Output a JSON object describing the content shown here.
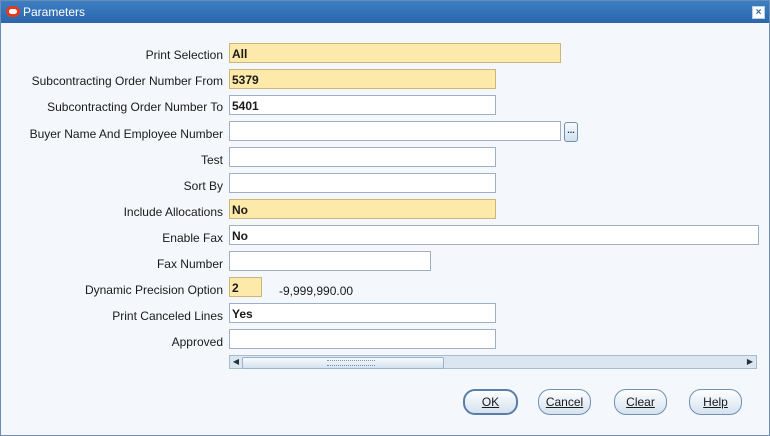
{
  "window": {
    "title": "Parameters",
    "close_glyph": "×"
  },
  "fields": [
    {
      "label": "Print Selection",
      "value": "All"
    },
    {
      "label": "Subcontracting Order Number From",
      "value": "5379"
    },
    {
      "label": "Subcontracting Order Number To",
      "value": "5401"
    },
    {
      "label": "Buyer Name And Employee Number",
      "value": ""
    },
    {
      "label": "Test",
      "value": ""
    },
    {
      "label": "Sort By",
      "value": ""
    },
    {
      "label": "Include Allocations",
      "value": "No"
    },
    {
      "label": "Enable Fax",
      "value": "No"
    },
    {
      "label": "Fax Number",
      "value": ""
    },
    {
      "label": "Dynamic Precision Option",
      "value": "2"
    },
    {
      "label": "Print Canceled Lines",
      "value": "Yes"
    },
    {
      "label": "Approved",
      "value": ""
    }
  ],
  "precision_hint": "-9,999,990.00",
  "lov_glyph": "...",
  "scroll": {
    "left_arrow": "◀",
    "right_arrow": "▶"
  },
  "buttons": {
    "ok": "OK",
    "cancel": "Cancel",
    "clear": "Clear",
    "help": "Help"
  },
  "colors": {
    "title_bar": "#2a66ab",
    "required_field": "#fde9a9"
  }
}
